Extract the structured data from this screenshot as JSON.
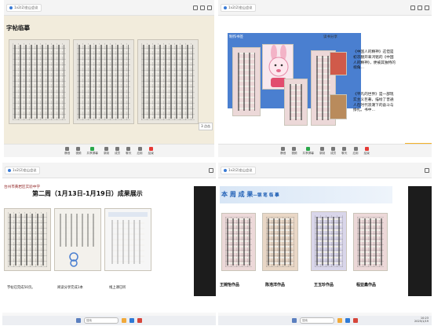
{
  "quadrants": {
    "tl": {
      "tab": "1v2(2)金山会议",
      "title": "字帖临摹",
      "side_caption": "3 点击",
      "bar": [
        "静音",
        "视频",
        "共享屏幕",
        "录制",
        "成员",
        "聊天",
        "应用",
        "结束"
      ]
    },
    "tr": {
      "tab": "1v2(2)金山会议",
      "label_left": "制作书签",
      "label_right": "读书分享",
      "text1": "《中国人的精神》这但是初次翻开辜鸿铭的《中国人的精神》，便被其独特的视角…",
      "text2": "《平凡的世界》是一部现实主义巨著，描绘了普通人在时代浪潮下的奋斗与挣扎。书中…",
      "bar": [
        "静音",
        "视频",
        "共享屏幕",
        "录制",
        "成员",
        "聊天",
        "应用",
        "结束"
      ]
    },
    "bl": {
      "tab": "1v2(2)金山会议",
      "logo": "台州市黄岩区实验中学",
      "title": "第二周（1月13日-1月19日）成果展示",
      "captions": [
        "字帖已完成50页。",
        "阅读分享完成1本",
        "线上课已听"
      ]
    },
    "br": {
      "tab": "1v2(2)金山会议",
      "title": "本 周 成 果",
      "subtitle": "—钢 笔 临 摹",
      "captions": [
        "王婉怡作品",
        "陈浩洋作品",
        "王玉珍作品",
        "程亚鑫作品"
      ]
    }
  },
  "taskbar": {
    "search_placeholder": "搜索",
    "time": "10:23",
    "date": "2025/1/19"
  }
}
